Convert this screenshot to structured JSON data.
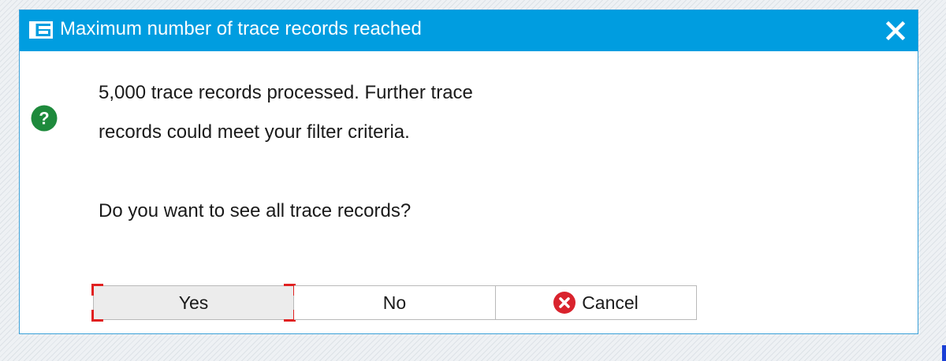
{
  "dialog": {
    "title": "Maximum number of trace records reached",
    "title_icon": "dialog-window-icon",
    "close_icon": "close-icon",
    "message_icon": "question-icon",
    "message_line1": "5,000 trace records processed. Further trace",
    "message_line2": "records could meet your filter criteria.",
    "question": "Do you want to see all trace records?",
    "buttons": {
      "yes": "Yes",
      "no": "No",
      "cancel": "Cancel"
    },
    "cancel_icon": "cancel-x-icon",
    "colors": {
      "titlebar": "#009de0",
      "question_icon": "#1e8a3c",
      "cancel_icon": "#d9232d",
      "focus_marker": "#e02020"
    }
  }
}
